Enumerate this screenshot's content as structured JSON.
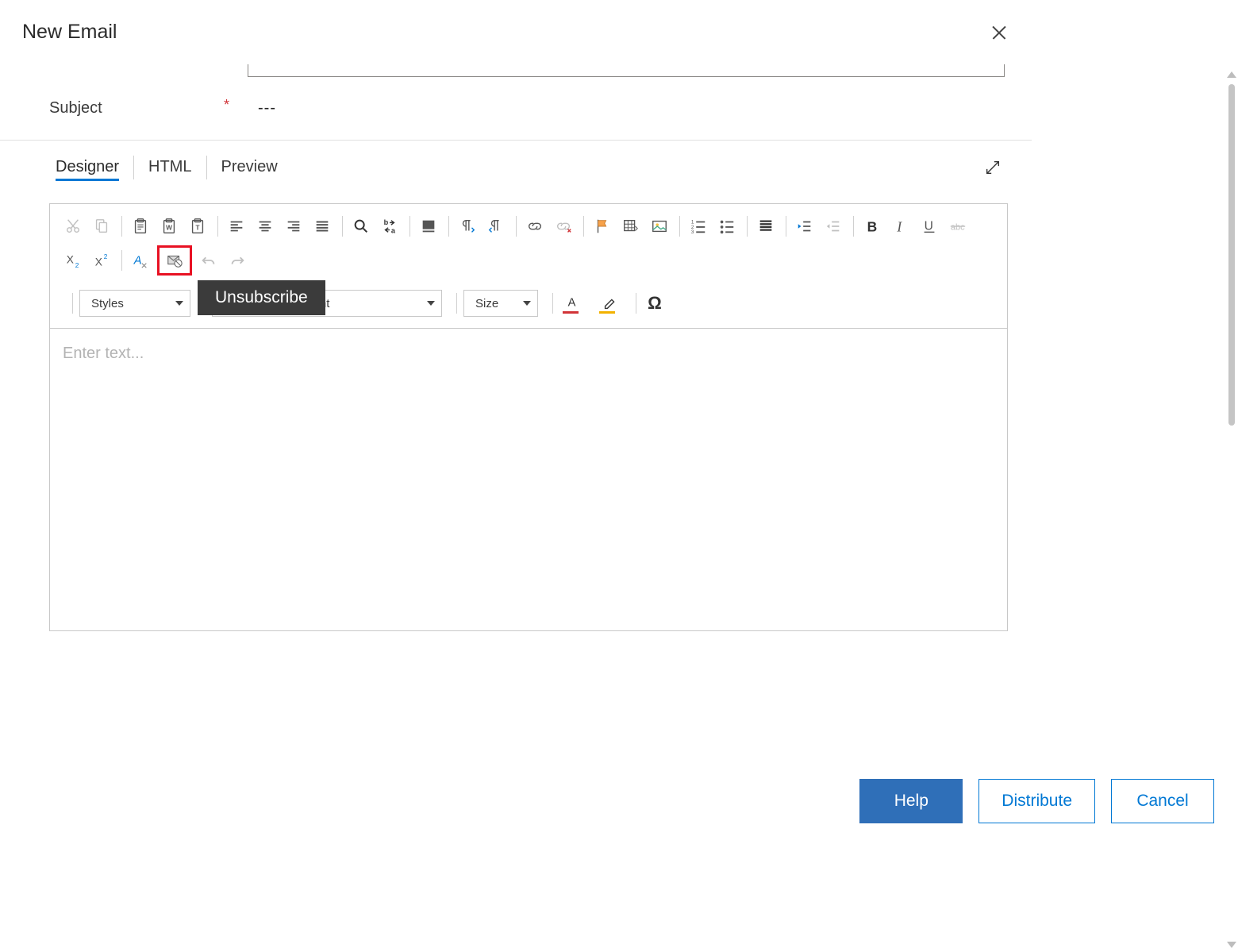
{
  "dialog": {
    "title": "New Email"
  },
  "form": {
    "subject_label": "Subject",
    "subject_value": "---"
  },
  "tabs": {
    "designer": "Designer",
    "html": "HTML",
    "preview": "Preview"
  },
  "toolbar": {
    "styles_label": "Styles",
    "font_label_partial": "ont",
    "size_label": "Size",
    "tooltip": "Unsubscribe"
  },
  "editor": {
    "placeholder": "Enter text..."
  },
  "footer": {
    "help": "Help",
    "distribute": "Distribute",
    "cancel": "Cancel"
  }
}
